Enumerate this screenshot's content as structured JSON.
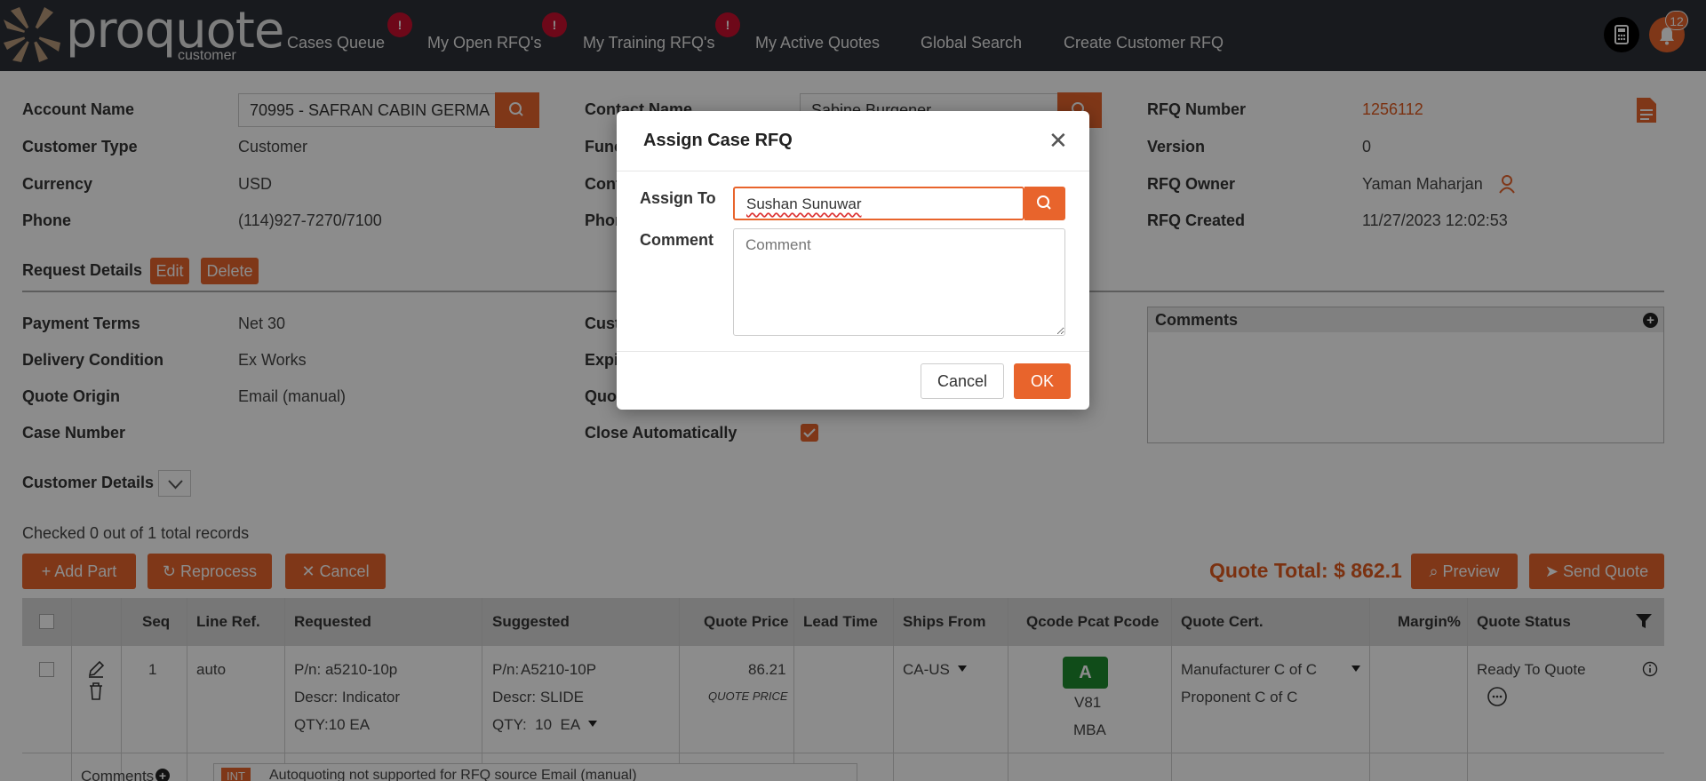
{
  "nav": {
    "logo_text": "proquote",
    "logo_sub": "customer",
    "items": [
      {
        "label": "Cases Queue",
        "badge": "!"
      },
      {
        "label": "My Open RFQ's",
        "badge": "!"
      },
      {
        "label": "My Training RFQ's",
        "badge": "!"
      },
      {
        "label": "My Active Quotes"
      },
      {
        "label": "Global Search"
      },
      {
        "label": "Create Customer RFQ"
      }
    ],
    "notification_count": "12"
  },
  "account": {
    "account_name_label": "Account Name",
    "account_name_value": "70995 - SAFRAN CABIN GERMA",
    "customer_type_label": "Customer Type",
    "customer_type_value": "Customer",
    "currency_label": "Currency",
    "currency_value": "USD",
    "phone_label": "Phone",
    "phone_value": "(114)927-7270/7100",
    "contact_name_label": "Contact Name",
    "contact_name_value": "Sabine Burgener",
    "func_label_partial": "Func",
    "cont_label_partial": "Cont",
    "phon_label_partial": "Phon"
  },
  "rfq": {
    "number_label": "RFQ Number",
    "number_value": "1256112",
    "version_label": "Version",
    "version_value": "0",
    "owner_label": "RFQ Owner",
    "owner_value": "Yaman Maharjan",
    "created_label": "RFQ Created",
    "created_value": "11/27/2023 12:02:53"
  },
  "request": {
    "title": "Request Details",
    "edit_label": "Edit",
    "delete_label": "Delete",
    "payment_terms_label": "Payment Terms",
    "payment_terms_value": "Net 30",
    "delivery_condition_label": "Delivery Condition",
    "delivery_condition_value": "Ex Works",
    "quote_origin_label": "Quote Origin",
    "quote_origin_value": "Email (manual)",
    "case_number_label": "Case Number",
    "cust_label_partial": "Cust",
    "expi_label_partial": "Expi",
    "quo_label_partial": "Quo",
    "close_auto_label": "Close Automatically",
    "close_auto_checked": true,
    "comments_title": "Comments"
  },
  "customer_details_label": "Customer Details",
  "records_text": "Checked 0 out of 1 total records",
  "actions": {
    "add_part": "Add Part",
    "reprocess": "Reprocess",
    "cancel": "Cancel",
    "quote_total": "Quote Total: $ 862.1",
    "preview": "Preview",
    "send_quote": "Send Quote"
  },
  "table": {
    "headers": [
      "Seq",
      "Line Ref.",
      "Requested",
      "Suggested",
      "Quote Price",
      "Lead Time",
      "Ships From",
      "Qcode Pcat Pcode",
      "Quote Cert.",
      "Margin%",
      "Quote Status"
    ],
    "row": {
      "seq": "1",
      "line_ref": "auto",
      "req_pn": "P/n: a5210-10p",
      "req_descr": "Descr: Indicator",
      "req_qty": "QTY:10 EA",
      "sug_pn_prefix": "P/n:",
      "sug_pn": "A5210-10P",
      "sug_descr": "Descr: SLIDE",
      "sug_qty": "QTY:  10  EA",
      "quote_price": "86.21",
      "quote_price_sub": "QUOTE PRICE",
      "ships_from": "CA-US",
      "qcode": "A",
      "pcat": "V81",
      "pcode": "MBA",
      "cert1": "Manufacturer C of C",
      "cert2": "Proponent C of C",
      "status": "Ready To Quote"
    },
    "comments_label": "Comments",
    "comment_tag": "INT",
    "comment_text": "Autoquoting not supported for RFQ source Email (manual)"
  },
  "modal": {
    "title": "Assign Case RFQ",
    "assign_to_label": "Assign To",
    "assign_to_value": "Sushan Sunuwar",
    "comment_label": "Comment",
    "comment_placeholder": "Comment",
    "cancel_label": "Cancel",
    "ok_label": "OK"
  },
  "colors": {
    "accent": "#e8642c",
    "nav_bg": "#2d3037",
    "badge": "#c8102e",
    "qcode_green": "#1e8a2e"
  }
}
